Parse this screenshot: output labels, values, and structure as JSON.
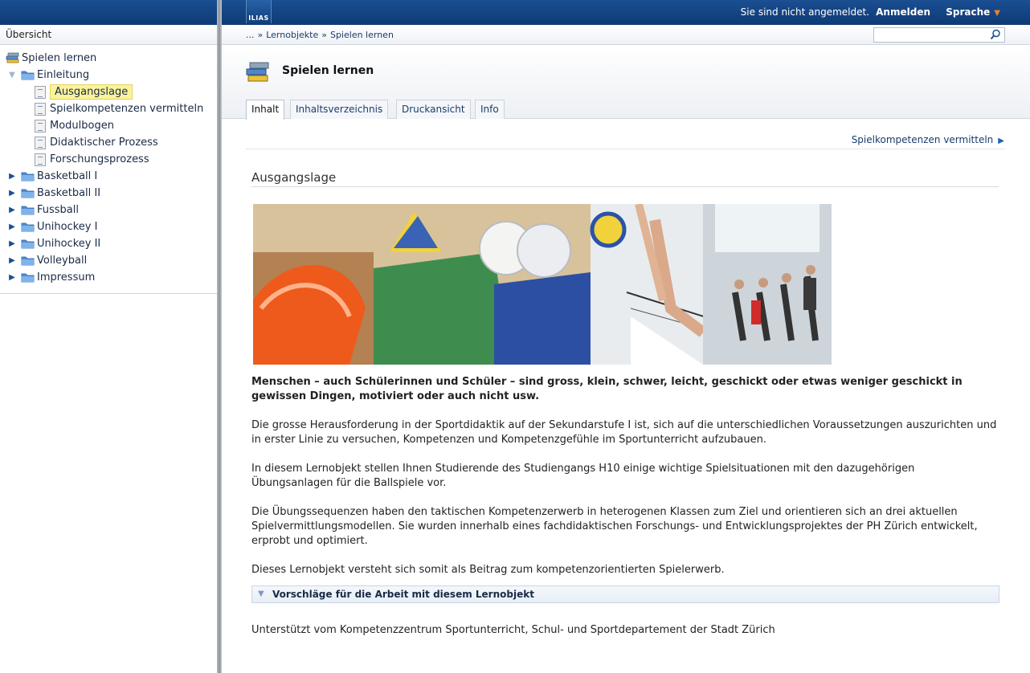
{
  "left_panel": {
    "heading": "Übersicht",
    "tree": [
      {
        "label": "Spielen lernen",
        "icon": "learning-module-icon",
        "level": 0,
        "toggle": "none"
      },
      {
        "label": "Einleitung",
        "icon": "folder-icon",
        "level": 1,
        "toggle": "open"
      },
      {
        "label": "Ausgangslage",
        "icon": "page-icon",
        "level": 2,
        "toggle": "none",
        "current": true
      },
      {
        "label": "Spielkompetenzen vermitteln",
        "icon": "page-icon",
        "level": 2,
        "toggle": "none"
      },
      {
        "label": "Modulbogen",
        "icon": "page-icon",
        "level": 2,
        "toggle": "none"
      },
      {
        "label": "Didaktischer Prozess",
        "icon": "page-icon",
        "level": 2,
        "toggle": "none"
      },
      {
        "label": "Forschungsprozess",
        "icon": "page-icon",
        "level": 2,
        "toggle": "none"
      },
      {
        "label": "Basketball I",
        "icon": "folder-icon",
        "level": 1,
        "toggle": "closed"
      },
      {
        "label": "Basketball II",
        "icon": "folder-icon",
        "level": 1,
        "toggle": "closed"
      },
      {
        "label": "Fussball",
        "icon": "folder-icon",
        "level": 1,
        "toggle": "closed"
      },
      {
        "label": "Unihockey I",
        "icon": "folder-icon",
        "level": 1,
        "toggle": "closed"
      },
      {
        "label": "Unihockey II",
        "icon": "folder-icon",
        "level": 1,
        "toggle": "closed"
      },
      {
        "label": "Volleyball",
        "icon": "folder-icon",
        "level": 1,
        "toggle": "closed"
      },
      {
        "label": "Impressum",
        "icon": "folder-icon",
        "level": 1,
        "toggle": "closed"
      }
    ]
  },
  "topbar": {
    "logo_text": "ILIAS",
    "login_status": "Sie sind nicht angemeldet.",
    "login_link": "Anmelden",
    "language": "Sprache"
  },
  "breadcrumb": {
    "items": [
      "...",
      "Lernobjekte",
      "Spielen lernen"
    ],
    "separator": "»"
  },
  "search": {
    "value": "",
    "placeholder": ""
  },
  "header": {
    "title": "Spielen lernen",
    "tabs": [
      {
        "label": "Inhalt",
        "active": true
      },
      {
        "label": "Inhaltsverzeichnis",
        "active": false
      },
      {
        "label": "Druckansicht",
        "active": false
      },
      {
        "label": "Info",
        "active": false
      }
    ]
  },
  "content": {
    "next_link": "Spielkompetenzen vermitteln",
    "section_title": "Ausgangslage",
    "intro_bold": "Menschen – auch Schülerinnen und Schüler – sind gross, klein, schwer, leicht, geschickt oder etwas weniger geschickt in gewissen Dingen, motiviert oder auch nicht usw.",
    "paragraphs": [
      "Die grosse Herausforderung in der Sportdidaktik auf der Sekundarstufe I ist, sich auf die unterschiedlichen Voraussetzungen auszurichten und in erster Linie zu versuchen, Kompetenzen und Kompetenzgefühle im Sportunterricht aufzubauen.",
      "In diesem Lernobjekt stellen Ihnen Studierende des Studiengangs H10 einige wichtige Spielsituationen mit den dazugehörigen Übungsanlagen für die Ballspiele vor.",
      "Die Übungssequenzen haben den taktischen Kompetenzerwerb in heterogenen Klassen zum Ziel und orientieren sich an drei aktuellen Spielvermittlungsmodellen. Sie wurden innerhalb eines fachdidaktischen Forschungs- und Entwicklungsprojektes der PH Zürich entwickelt, erprobt und optimiert.",
      "Dieses Lernobjekt versteht sich somit als Beitrag zum kompetenzorientierten Spielerwerb."
    ],
    "accordion_label": "Vorschläge für die Arbeit mit diesem Lernobjekt",
    "footer_text": "Unterstützt vom Kompetenzzentrum Sportunterricht, Schul- und Sportdepartement der Stadt Zürich"
  },
  "colors": {
    "topbar": "#0f3a76",
    "link": "#1a3c6c",
    "highlight": "#fbf39c",
    "accent_orange": "#f07d2a"
  }
}
